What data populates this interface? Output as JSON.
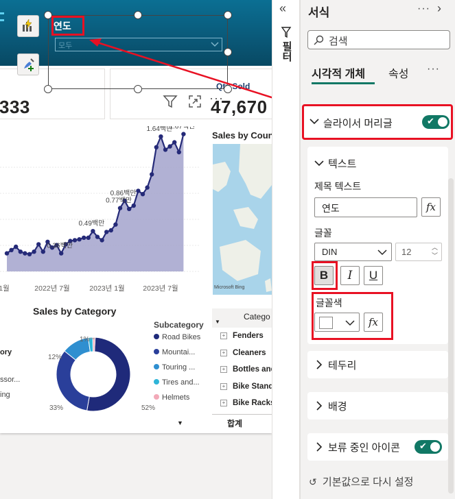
{
  "slicer": {
    "title": "연도",
    "value": "모두"
  },
  "cards": [
    {
      "value": "333"
    },
    {
      "label": "Qty Sold",
      "value": "47,670"
    }
  ],
  "line_chart": {
    "x_ticks": [
      "1월",
      "2022년 7월",
      "2023년 1월",
      "2023년 7월"
    ],
    "data_labels": [
      "1.64백만",
      "1.67백만",
      "0.86백만",
      "0.77백만",
      "0.49백만",
      "0.36백만"
    ]
  },
  "map": {
    "title": "Sales by Coun",
    "attribution": "Microsoft Bing"
  },
  "category_chart": {
    "title": "Sales by Category",
    "legend_title": "Subcategory",
    "legend": [
      {
        "label": "Road Bikes",
        "color": "#1f2a7a"
      },
      {
        "label": "Mountai...",
        "color": "#2a3f9a"
      },
      {
        "label": "Touring ...",
        "color": "#2f8fd0"
      },
      {
        "label": "Tires and...",
        "color": "#2fb5d8"
      },
      {
        "label": "Helmets",
        "color": "#f2a9b8"
      }
    ],
    "pct_labels": [
      "1%",
      "12%",
      "33%",
      "52%"
    ],
    "left_partial": [
      "ory",
      "ssor...",
      "ing"
    ]
  },
  "table": {
    "header": "Catego",
    "rows": [
      "Fenders",
      "Cleaners",
      "Bottles and",
      "Bike Stand",
      "Bike Racks"
    ],
    "total": "합계"
  },
  "filter_strip": {
    "label": "필터"
  },
  "pane": {
    "title": "서식",
    "search_placeholder": "검색",
    "tabs": [
      "시각적 개체",
      "속성"
    ],
    "sections": {
      "slicer_header": "슬라이서 머리글",
      "text": "텍스트",
      "title_text_label": "제목 텍스트",
      "title_text_value": "연도",
      "font_label": "글꼴",
      "font_family": "DIN",
      "font_size": "12",
      "bold": "B",
      "italic": "I",
      "underline": "U",
      "font_color_label": "글꼴색",
      "border": "테두리",
      "background": "배경",
      "pending_icon": "보류 중인 아이콘",
      "reset": "기본값으로 다시 설정"
    },
    "fx": "fx",
    "accent": "#117865",
    "highlight": "#e81123"
  },
  "chart_data": {
    "type": "area",
    "series": [
      {
        "values": [
          0.22,
          0.26,
          0.3,
          0.24,
          0.22,
          0.21,
          0.24,
          0.33,
          0.24,
          0.36,
          0.29,
          0.32,
          0.22,
          0.33,
          0.37,
          0.38,
          0.39,
          0.41,
          0.41,
          0.49,
          0.42,
          0.38,
          0.48,
          0.5,
          0.57,
          0.77,
          0.86,
          0.76,
          0.8,
          0.98,
          0.94,
          1.02,
          1.18,
          1.51,
          1.64,
          1.48,
          1.52,
          1.57,
          1.45,
          1.67
        ]
      }
    ],
    "labeled_points": [
      {
        "index": 34,
        "value": 1.64
      },
      {
        "index": 39,
        "value": 1.67
      },
      {
        "index": 26,
        "value": 0.86
      },
      {
        "index": 25,
        "value": 0.77
      },
      {
        "index": 19,
        "value": 0.49
      },
      {
        "index": 12,
        "value": 0.36
      }
    ],
    "donut": {
      "values": [
        52,
        33,
        12,
        2,
        1
      ]
    }
  }
}
